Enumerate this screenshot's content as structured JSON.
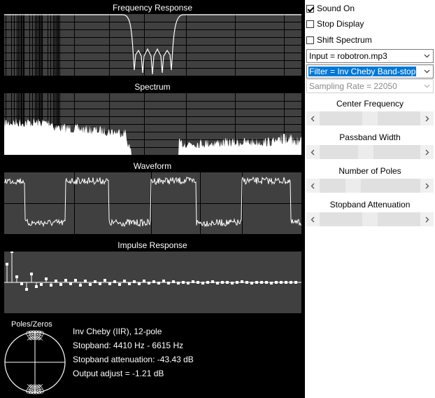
{
  "plots": {
    "frequency_response": {
      "title": "Frequency Response"
    },
    "spectrum": {
      "title": "Spectrum"
    },
    "waveform": {
      "title": "Waveform"
    },
    "impulse_response": {
      "title": "Impulse Response"
    }
  },
  "poles_zeros": {
    "title": "Poles/Zeros"
  },
  "info": {
    "line1": "Inv Cheby (IIR), 12-pole",
    "line2": "Stopband: 4410 Hz - 6615 Hz",
    "line3": "Stopband attenuation: -43.43 dB",
    "line4": "Output adjust = -1.21 dB"
  },
  "controls": {
    "sound_on": {
      "label": "Sound On",
      "checked": true
    },
    "stop_display": {
      "label": "Stop Display",
      "checked": false
    },
    "shift_spectrum": {
      "label": "Shift Spectrum",
      "checked": false
    },
    "input_select": {
      "value": "Input = robotron.mp3"
    },
    "filter_select": {
      "value": "Filter = Inv Cheby Band-stop"
    },
    "rate_select": {
      "value": "Sampling Rate = 22050"
    },
    "sliders": [
      {
        "label": "Center Frequency",
        "value": 0.5
      },
      {
        "label": "Passband Width",
        "value": 0.45
      },
      {
        "label": "Number of Poles",
        "value": 0.3
      },
      {
        "label": "Stopband Attenuation",
        "value": 0.5
      }
    ]
  },
  "colors": {
    "plot_bg": "#404040",
    "grid": "#000000",
    "trace": "#ffffff",
    "highlight": "#0078d7"
  }
}
